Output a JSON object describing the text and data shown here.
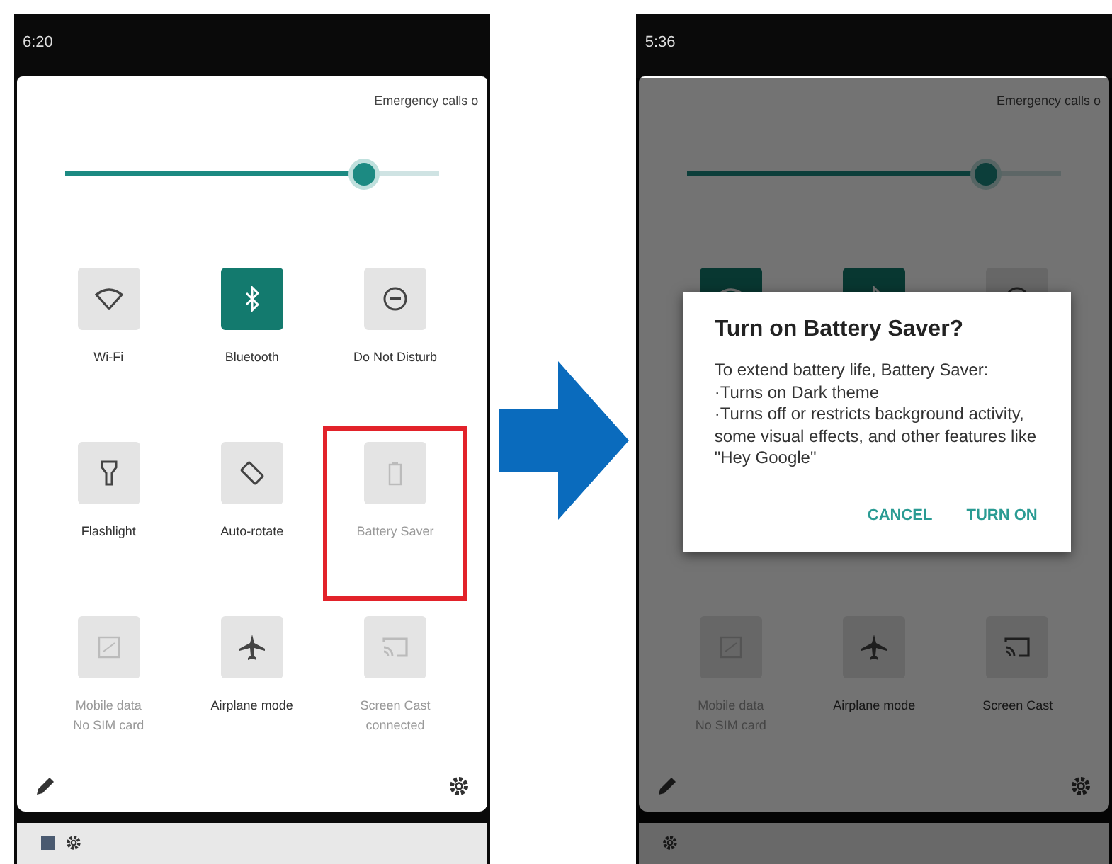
{
  "screens": [
    {
      "time": "6:20",
      "emergency": "Emergency calls o",
      "brightness": {
        "level": 0.8
      },
      "tiles": [
        {
          "kind": "wifi",
          "label": "Wi-Fi",
          "on": false,
          "disabled": false,
          "highlighted": false
        },
        {
          "kind": "bluetooth",
          "label": "Bluetooth",
          "on": true,
          "disabled": false,
          "highlighted": false
        },
        {
          "kind": "dnd",
          "label": "Do Not Disturb",
          "on": false,
          "disabled": false,
          "highlighted": false
        },
        {
          "kind": "flashlight",
          "label": "Flashlight",
          "on": false,
          "disabled": false,
          "highlighted": false
        },
        {
          "kind": "rotate",
          "label": "Auto-rotate",
          "on": false,
          "disabled": false,
          "highlighted": false
        },
        {
          "kind": "battery",
          "label": "Battery Saver",
          "on": false,
          "disabled": true,
          "highlighted": true
        },
        {
          "kind": "data",
          "label": "Mobile data",
          "sublabel": "No SIM card",
          "on": false,
          "disabled": true,
          "highlighted": false
        },
        {
          "kind": "airplane",
          "label": "Airplane mode",
          "on": false,
          "disabled": false,
          "highlighted": false
        },
        {
          "kind": "cast",
          "label": "Screen Cast",
          "sublabel": "connected",
          "on": false,
          "disabled": true,
          "highlighted": false
        }
      ]
    },
    {
      "time": "5:36",
      "emergency": "Emergency calls o",
      "brightness": {
        "level": 0.8
      },
      "tiles": [
        {
          "kind": "wifi",
          "on": true,
          "disabled": false,
          "highlighted": false
        },
        {
          "kind": "bluetooth",
          "on": true,
          "disabled": false,
          "highlighted": false
        },
        {
          "kind": "dnd",
          "on": false,
          "disabled": false,
          "highlighted": false
        },
        {
          "kind": "data",
          "label": "Mobile data",
          "sublabel": "No SIM card",
          "on": false,
          "disabled": true,
          "highlighted": false
        },
        {
          "kind": "airplane",
          "label": "Airplane mode",
          "on": false,
          "disabled": false,
          "highlighted": false
        },
        {
          "kind": "cast",
          "label": "Screen Cast",
          "on": false,
          "disabled": false,
          "highlighted": false
        }
      ],
      "dialog": {
        "title": "Turn on Battery Saver?",
        "body": "To extend battery life, Battery Saver:\n·Turns on Dark theme\n·Turns off or restricts background activity, some visual effects, and other features like \"Hey Google\"",
        "buttons": [
          "CANCEL",
          "TURN ON"
        ]
      }
    }
  ]
}
